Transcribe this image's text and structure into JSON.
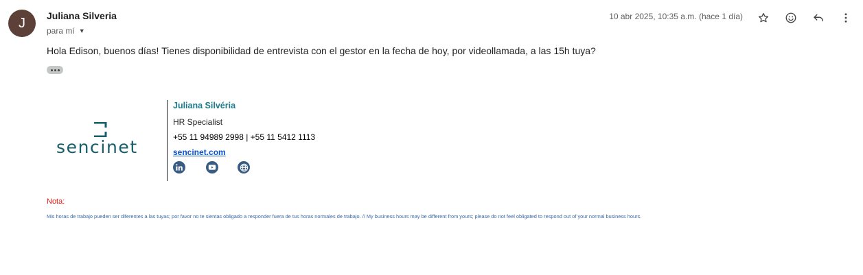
{
  "sender": {
    "initial": "J",
    "name": "Juliana Silveria",
    "to_label": "para mí"
  },
  "meta": {
    "date": "10 abr 2025, 10:35 a.m. (hace 1 día)"
  },
  "message": {
    "body": "Hola Edison, buenos días! Tienes disponibilidad de entrevista con el gestor en la fecha de hoy, por videollamada, a las 15h tuya?"
  },
  "signature": {
    "logo_text": "sencinet",
    "name": "Juliana Silvéria",
    "title": "HR Specialist",
    "phones": "+55 11 94989 2998 | +55 11 5412 1113",
    "website": "sencinet.com"
  },
  "note": {
    "label": "Nota:",
    "text": "Mis horas de trabajo pueden ser diferentes a las tuyas; por favor no te sientas obligado a responder fuera de tus horas normales de trabajo. // My business hours may be different from yours; please do not feel obligated to respond out of your normal business hours."
  },
  "colors": {
    "avatar": "#5d4037",
    "brand": "#155e6a",
    "sig_name": "#1d7a8c",
    "link": "#1155cc",
    "note_label": "#e8160c",
    "note_text": "#3b6aa6"
  },
  "icons": [
    "star-icon",
    "emoji-icon",
    "reply-icon",
    "more-vert-icon",
    "chevron-down-icon",
    "linkedin-icon",
    "youtube-icon",
    "globe-icon"
  ]
}
